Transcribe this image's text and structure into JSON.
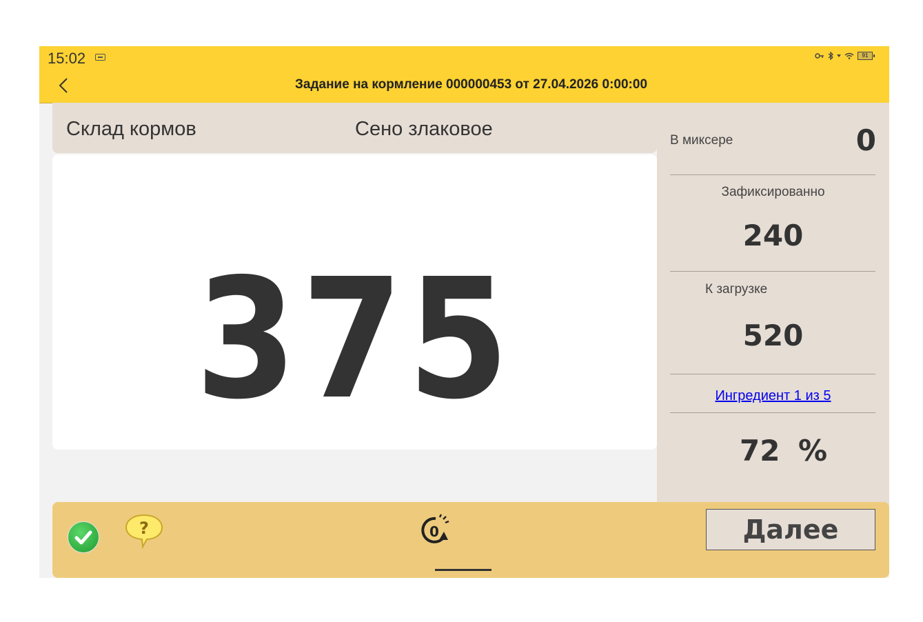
{
  "status_bar": {
    "time": "15:02",
    "battery": "91",
    "icons": [
      "sim-card-icon",
      "key-icon",
      "bluetooth-icon",
      "signal-icon",
      "wifi-icon",
      "battery-icon"
    ]
  },
  "header": {
    "title": "Задание на кормление 000000453 от 27.04.2026 0:00:00",
    "back_icon": "chevron-left-icon"
  },
  "main": {
    "warehouse": "Склад кормов",
    "ingredient_name": "Сено злаковое",
    "current_weight": "375"
  },
  "summary": {
    "in_mixer_label": "В миксере",
    "in_mixer_value": "0",
    "fixed_label": "Зафиксированно",
    "fixed_value": "240",
    "to_load_label": "К загрузке",
    "to_load_value": "520",
    "ingredient_link": "Ингредиент 1 из 5",
    "percent_value": "72",
    "percent_sign": "%"
  },
  "bottom_bar": {
    "next_label": "Далее",
    "icons": [
      "checkmark-circle-icon",
      "help-bubble-icon",
      "tare-zero-icon"
    ]
  },
  "colors": {
    "header_yellow": "#fdd232",
    "panel_beige": "#e6ddd5",
    "bottom_bar": "#eecb7c",
    "value_text": "#333333",
    "link": "#0000ee"
  }
}
